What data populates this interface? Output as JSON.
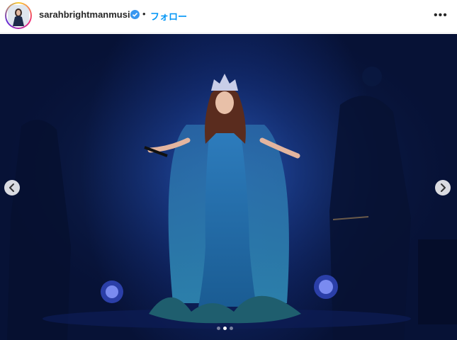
{
  "header": {
    "username": "sarahbrightmanmusic",
    "separator": "•",
    "follow_label": "フォロー",
    "more_label": "•••",
    "avatar_icon": "profile-avatar-icon",
    "verified_icon": "verified-badge-icon"
  },
  "carousel": {
    "prev_icon": "chevron-left-icon",
    "next_icon": "chevron-right-icon",
    "slide_count": 3,
    "active_slide": 2
  },
  "colors": {
    "follow_accent": "#0095f6",
    "verified_blue": "#3897f0",
    "stage_blue": "#0f2463"
  }
}
